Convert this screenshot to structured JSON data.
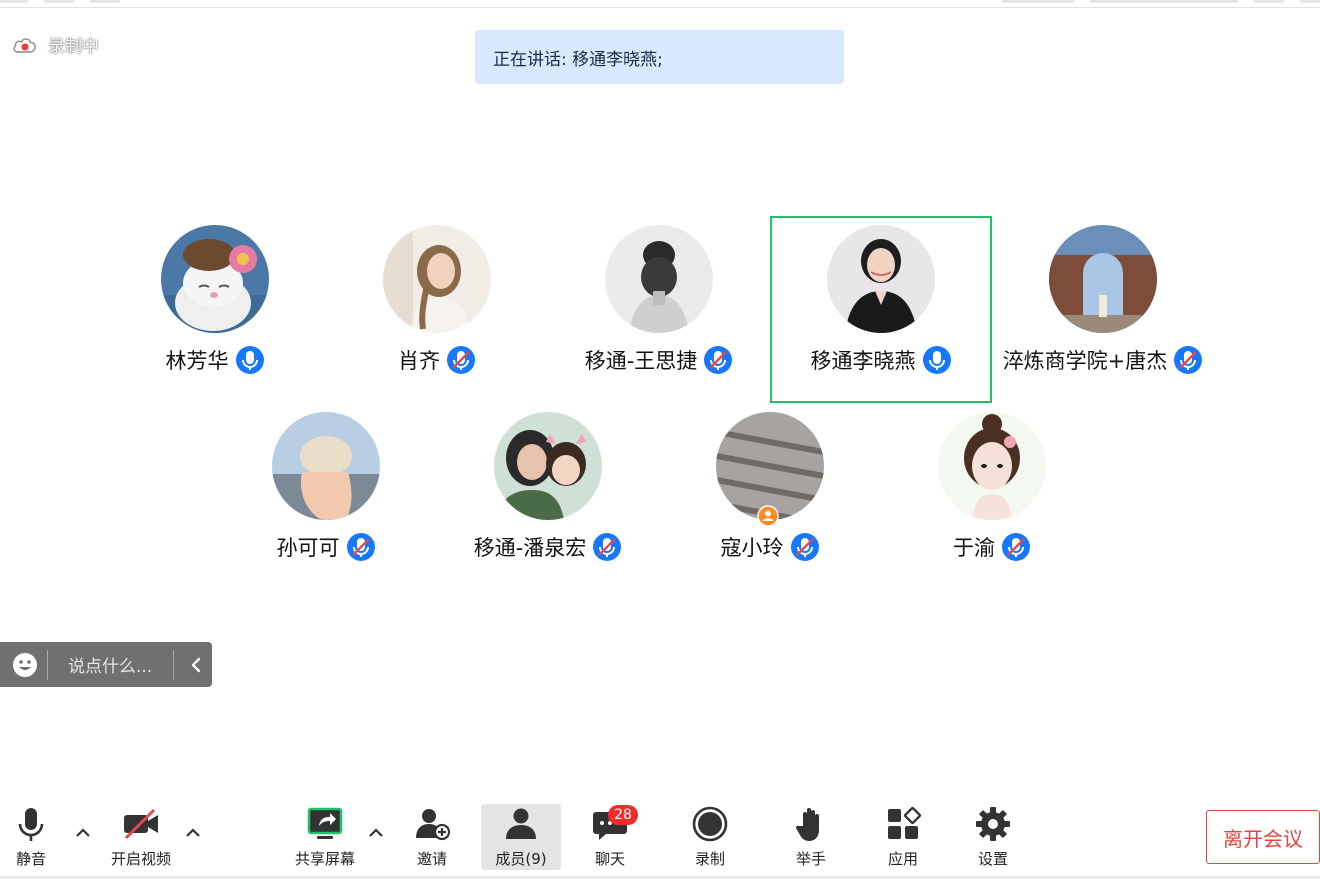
{
  "recording": {
    "label": "录制中",
    "icon": "cloud-record-icon"
  },
  "speaking": {
    "text": "正在讲话: 移通李晓燕;"
  },
  "participants": [
    {
      "name": "林芳华",
      "mic": "on"
    },
    {
      "name": "肖齐",
      "mic": "muted"
    },
    {
      "name": "移通-王思捷",
      "mic": "muted"
    },
    {
      "name": "移通李晓燕",
      "mic": "on",
      "speaking": true
    },
    {
      "name": "淬炼商学院+唐杰",
      "mic": "muted"
    },
    {
      "name": "孙可可",
      "mic": "muted"
    },
    {
      "name": "移通-潘泉宏",
      "mic": "muted"
    },
    {
      "name": "寇小玲",
      "mic": "muted",
      "host": true
    },
    {
      "name": "于渝",
      "mic": "muted"
    }
  ],
  "chat_input": {
    "placeholder": "说点什么..."
  },
  "toolbar": {
    "mute": "静音",
    "video": "开启视频",
    "share": "共享屏幕",
    "invite": "邀请",
    "members": "成员(9)",
    "chat": "聊天",
    "chat_badge": "28",
    "record": "录制",
    "raise_hand": "举手",
    "apps": "应用",
    "settings": "设置",
    "leave": "离开会议"
  },
  "colors": {
    "speaking_bg": "#d9e8fc",
    "speaking_border": "#22c06a",
    "mic_blue": "#1677ff",
    "mute_red": "#e5484d",
    "leave_red": "#e2453f",
    "badge_red": "#f22b2b"
  }
}
